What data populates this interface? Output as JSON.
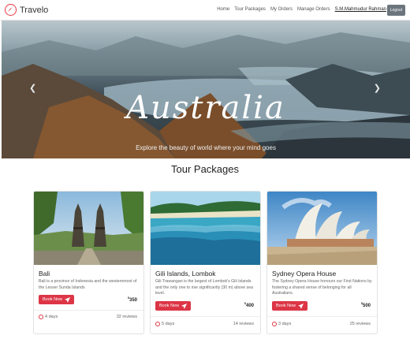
{
  "navbar": {
    "brand": "Travelo",
    "links": [
      "Home",
      "Tour Packages",
      "My Orders",
      "Manage Orders"
    ],
    "user": "S.M.Mahmudur Rahman",
    "logout": "Logout"
  },
  "hero": {
    "title": "Australia",
    "subtitle": "Explore the beauty of world where your mind goes",
    "slide_count": 3,
    "active_slide": 2
  },
  "section_title": "Tour Packages",
  "cards": [
    {
      "name": "Bali",
      "description": "Bali is a province of Indonesia and the westernmost of the Lesser Sunda Islands",
      "book_label": "Book Now",
      "price": "350",
      "days": "4 days",
      "reviews": "32 reviews"
    },
    {
      "name": "Gili Islands, Lombok",
      "description": "Gili Trawangan is the largest of Lombok's Gili Islands and the only one to rise significantly (30 m) above sea level.",
      "book_label": "Book Now",
      "price": "400",
      "days": "5 days",
      "reviews": "14 reviews"
    },
    {
      "name": "Sydney Opera House",
      "description": "The Sydney Opera House honours our First Nations by fostering a shared sense of belonging for all Australians.",
      "book_label": "Book Now",
      "price": "500",
      "days": "3 days",
      "reviews": "25 reviews"
    }
  ],
  "colors": {
    "accent": "#dc3545",
    "logout": "#6c757d"
  },
  "icons": {
    "brand": "compass-icon",
    "book": "paper-plane-icon",
    "duration": "clock-icon",
    "carousel_prev": "chevron-left-icon",
    "carousel_next": "chevron-right-icon"
  }
}
